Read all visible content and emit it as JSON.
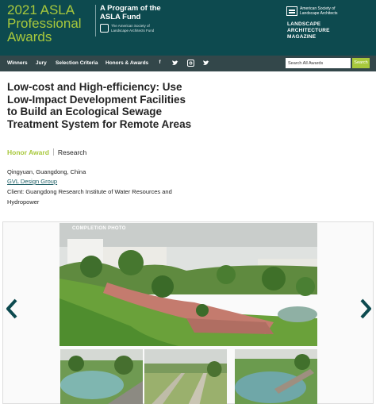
{
  "header": {
    "title_line1": "2021 ASLA",
    "title_line2": "Professional",
    "title_line3": "Awards",
    "program_line1": "A Program of the",
    "program_line2": "ASLA Fund",
    "fund_logo_text": "The American Society of Landscape Architects Fund",
    "asla_logo_text": "American Society of Landscape Architects",
    "magazine_line1": "LANDSCAPE",
    "magazine_line2": "ARCHITECTURE",
    "magazine_line3": "MAGAZINE"
  },
  "nav": {
    "items": [
      "Winners",
      "Jury",
      "Selection Criteria",
      "Honors & Awards"
    ],
    "social_icons": [
      "facebook-icon",
      "twitter-icon",
      "instagram-icon",
      "twitter-icon"
    ],
    "search_placeholder": "Search All Awards",
    "search_button": "Search"
  },
  "project": {
    "title": "Low-cost and High-efficiency: Use Low-Impact Development Facilities to Build an Ecological Sewage Treatment System for Remote Areas",
    "award": "Honor Award",
    "category": "Research",
    "location": "Qingyuan, Guangdong, China",
    "firm": "GVL Design Group",
    "client": "Client: Guangdong Research Institute of Water Resources and Hydropower"
  },
  "gallery": {
    "label": "COMPLETION PHOTO",
    "prev_icon": "chevron-left-icon",
    "next_icon": "chevron-right-icon"
  },
  "colors": {
    "header_bg": "#0d4a4f",
    "nav_bg": "#33474a",
    "accent_green": "#a8c83c",
    "link": "#1a5c63"
  }
}
